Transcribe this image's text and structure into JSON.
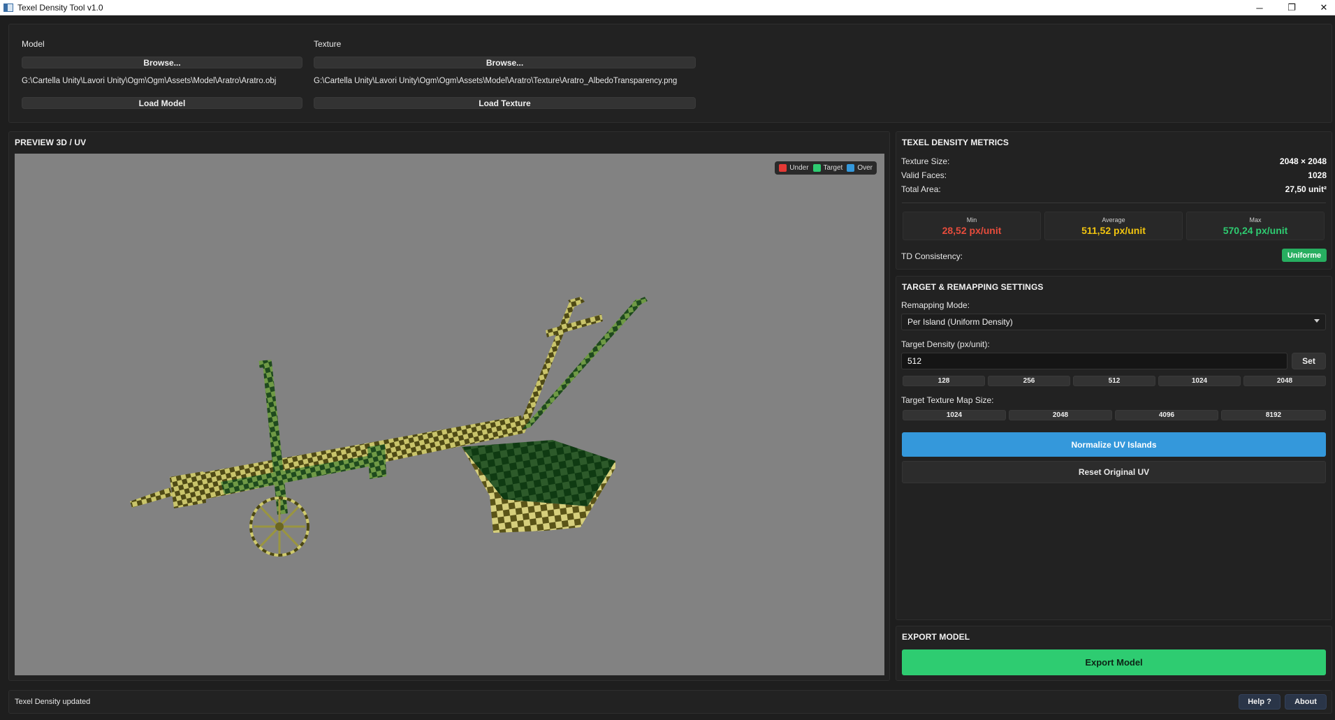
{
  "window": {
    "title": "Texel Density Tool v1.0",
    "minimize": "─",
    "maximize": "❐",
    "close": "✕"
  },
  "top": {
    "model_label": "Model",
    "model_browse": "Browse...",
    "model_path": "G:\\Cartella Unity\\Lavori Unity\\Ogm\\Ogm\\Assets\\Model\\Aratro\\Aratro.obj",
    "load_model": "Load Model",
    "texture_label": "Texture",
    "texture_browse": "Browse...",
    "texture_path": "G:\\Cartella Unity\\Lavori Unity\\Ogm\\Ogm\\Assets\\Model\\Aratro\\Texture\\Aratro_AlbedoTransparency.png",
    "load_texture": "Load Texture"
  },
  "preview": {
    "title": "PREVIEW 3D / UV",
    "legend": [
      {
        "label": "Under",
        "color": "#e53935"
      },
      {
        "label": "Target",
        "color": "#2ecc71"
      },
      {
        "label": "Over",
        "color": "#3498db"
      }
    ]
  },
  "metrics": {
    "title": "TEXEL DENSITY METRICS",
    "rows": [
      {
        "label": "Texture Size:",
        "value": "2048 × 2048"
      },
      {
        "label": "Valid Faces:",
        "value": "1028"
      },
      {
        "label": "Total Area:",
        "value": "27,50 unit²"
      }
    ],
    "min": {
      "caption": "Min",
      "value": "28,52 px/unit",
      "color": "#e74c3c"
    },
    "avg": {
      "caption": "Average",
      "value": "511,52 px/unit",
      "color": "#f1c40f"
    },
    "max": {
      "caption": "Max",
      "value": "570,24 px/unit",
      "color": "#2ecc71"
    },
    "consistency_label": "TD Consistency:",
    "consistency_badge": "Uniforme"
  },
  "target": {
    "title": "TARGET & REMAPPING SETTINGS",
    "mode_label": "Remapping Mode:",
    "mode_value": "Per Island (Uniform Density)",
    "density_label": "Target Density (px/unit):",
    "density_value": "512",
    "set_button": "Set",
    "density_presets": [
      "128",
      "256",
      "512",
      "1024",
      "2048"
    ],
    "map_label": "Target Texture Map Size:",
    "map_presets": [
      "1024",
      "2048",
      "4096",
      "8192"
    ],
    "normalize_button": "Normalize UV Islands",
    "reset_button": "Reset Original UV"
  },
  "export": {
    "title": "EXPORT MODEL",
    "button": "Export Model"
  },
  "status": {
    "text": "Texel Density updated",
    "help": "Help ?",
    "about": "About"
  },
  "colors": {
    "accent_blue": "#3498db",
    "accent_green": "#2ecc71",
    "bg": "#1e1e1e",
    "panel": "#222222"
  }
}
